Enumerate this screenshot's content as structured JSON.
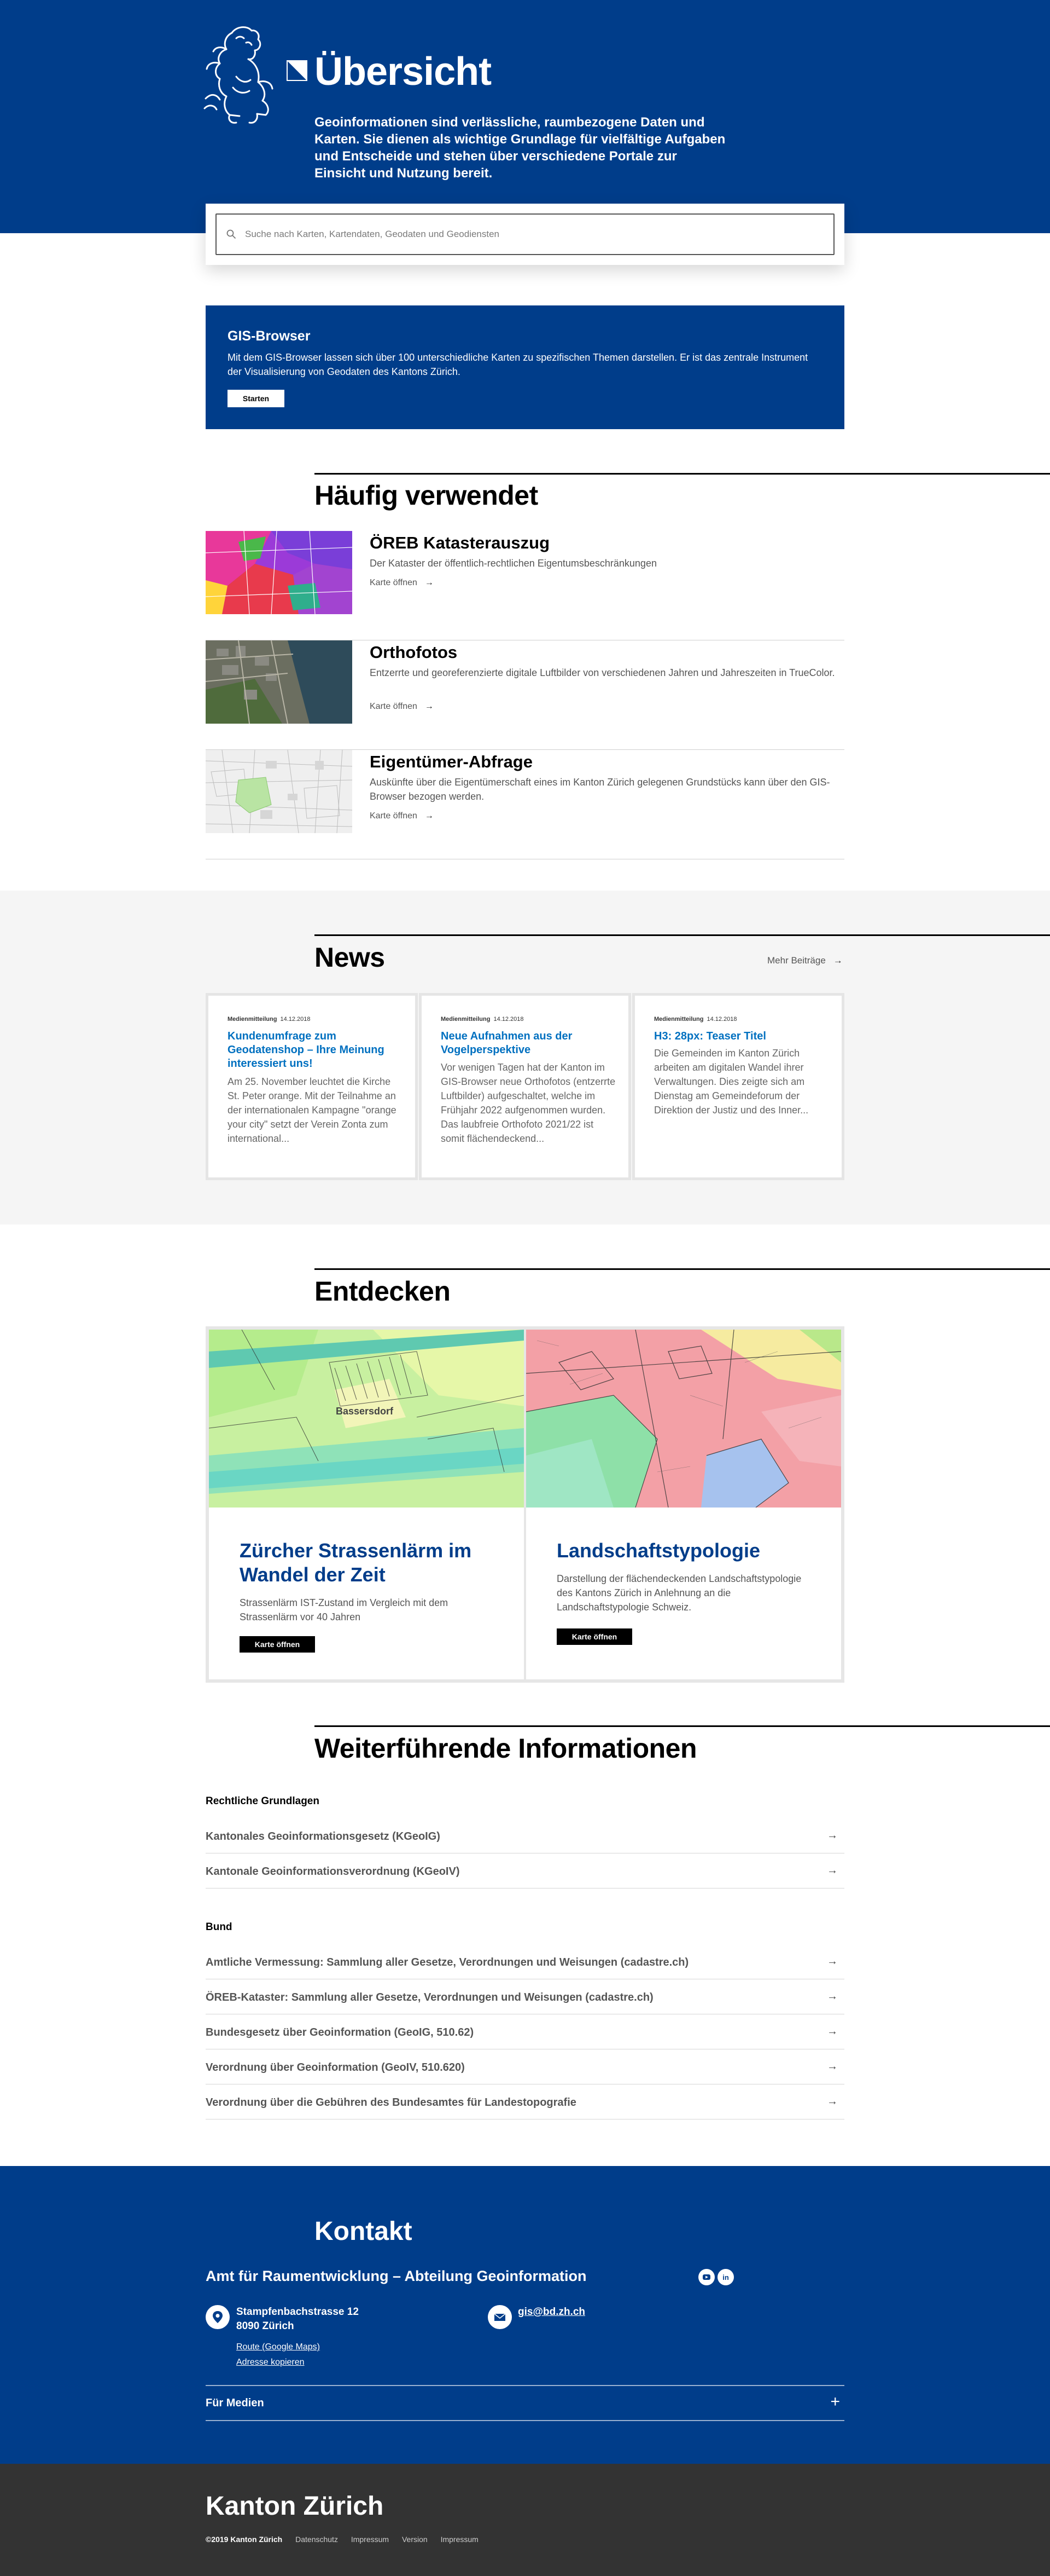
{
  "hero": {
    "title": "Übersicht",
    "lead": "Geoinformationen sind verlässliche, raumbezogene Daten und Karten. Sie dienen als wichtige Grundlage für vielfältige Aufgaben und Entscheide und stehen über verschiedene Portale zur Einsicht und Nutzung bereit."
  },
  "search": {
    "placeholder": "Suche nach Karten, Kartendaten, Geodaten und Geodiensten"
  },
  "gis_browser": {
    "title": "GIS-Browser",
    "text": "Mit dem GIS-Browser lassen sich über 100 unterschiedliche Karten zu spezifischen Themen darstellen. Er ist das zentrale Instrument der Visualisierung von Geodaten des Kantons Zürich.",
    "button": "Starten"
  },
  "frequent": {
    "title": "Häufig verwendet",
    "items": [
      {
        "title": "ÖREB Katasterauszug",
        "desc": "Der Kataster der öffentlich-rechtlichen Eigentumsbeschränkungen",
        "link": "Karte öffnen"
      },
      {
        "title": "Orthofotos",
        "desc": "Entzerrte und georeferenzierte digitale Luftbilder von verschiedenen Jahren und Jahreszeiten in TrueColor.",
        "link": "Karte öffnen"
      },
      {
        "title": "Eigentümer-Abfrage",
        "desc": "Auskünfte über die Eigentümerschaft eines im Kanton Zürich gelegenen Grundstücks kann über den GIS-Browser bezogen werden.",
        "link": "Karte öffnen"
      }
    ]
  },
  "news": {
    "title": "News",
    "more": "Mehr Beiträge",
    "cards": [
      {
        "type": "Medienmitteilung",
        "date": "14.12.2018",
        "title": "Kundenumfrage zum Geodatenshop – Ihre Meinung interessiert uns!",
        "text": "Am 25. November leuchtet die Kirche St. Peter orange. Mit der Teilnahme an der internationalen Kampagne \"orange your city\" setzt der Verein Zonta zum international..."
      },
      {
        "type": "Medienmitteilung",
        "date": "14.12.2018",
        "title": "Neue Aufnahmen aus der Vogelperspektive",
        "text": "Vor wenigen Tagen hat der Kanton im GIS-Browser neue Orthofotos (entzerrte Luftbilder) aufgeschaltet, welche im Frühjahr 2022 aufgenommen wurden. Das laubfreie Orthofoto 2021/22 ist somit flächendeckend..."
      },
      {
        "type": "Medienmitteilung",
        "date": "14.12.2018",
        "title": "H3: 28px: Teaser Titel",
        "text": "Die Gemeinden im Kanton Zürich arbeiten am digitalen Wandel ihrer Verwaltungen. Dies zeigte sich am Dienstag am Gemeindeforum der Direktion der Justiz und des Inner..."
      }
    ]
  },
  "discover": {
    "title": "Entdecken",
    "map_label": "Bassersdorf",
    "cards": [
      {
        "title": "Zürcher Strassenlärm im Wandel der Zeit",
        "text": "Strassenlärm IST-Zustand im Vergleich mit dem Strassenlärm vor 40 Jahren",
        "button": "Karte öffnen"
      },
      {
        "title": "Landschaftstypologie",
        "text": "Darstellung der flächendeckenden Landschaftstypologie des Kantons Zürich in Anlehnung an die Landschaftstypologie Schweiz.",
        "button": "Karte öffnen"
      }
    ]
  },
  "further": {
    "title": "Weiterführende Informationen",
    "groups": [
      {
        "title": "Rechtliche Grundlagen",
        "links": [
          "Kantonales Geoinformationsgesetz (KGeoIG)",
          "Kantonale Geoinformationsverordnung (KGeoIV)"
        ]
      },
      {
        "title": "Bund",
        "links": [
          "Amtliche Vermessung: Sammlung aller Gesetze, Verordnungen und Weisungen (cadastre.ch)",
          "ÖREB-Kataster: Sammlung aller Gesetze, Verordnungen und Weisungen (cadastre.ch)",
          "Bundesgesetz über Geoinformation (GeoIG, 510.62)",
          "Verordnung über Geoinformation (GeoIV, 510.620)",
          "Verordnung über die Gebühren des Bundesamtes für Landestopografie"
        ]
      }
    ]
  },
  "contact": {
    "title": "Kontakt",
    "org": "Amt für Raumentwicklung – Abteilung Geoinformation",
    "street": "Stampfenbachstrasse 12",
    "city": "8090 Zürich",
    "route": "Route (Google Maps)",
    "copy": "Adresse kopieren",
    "email": "gis@bd.zh.ch",
    "media": "Für Medien",
    "social": [
      "youtube-icon",
      "linkedin-icon"
    ]
  },
  "footer": {
    "title": "Kanton Zürich",
    "copyright": "©2019 Kanton Zürich",
    "links": [
      "Datenschutz",
      "Impressum",
      "Version",
      "Impressum"
    ]
  },
  "colors": {
    "primary": "#003d8a",
    "link": "#0070c0",
    "footer": "#333333",
    "news_bg": "#f5f5f5"
  }
}
